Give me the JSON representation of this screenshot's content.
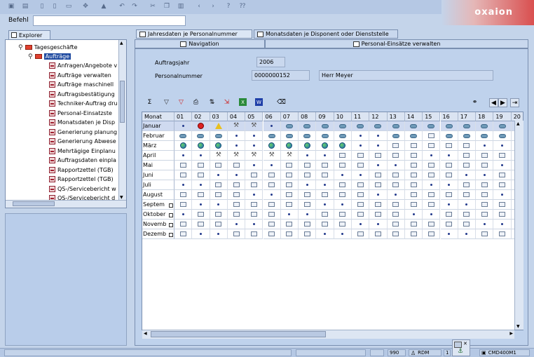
{
  "toolbar": {
    "icons": [
      "save-icon",
      "print-icon",
      "document-icon",
      "new-document-icon",
      "move-icon",
      "stamp-icon",
      "undo-icon",
      "redo-icon",
      "cut-icon",
      "copy-icon",
      "paste-icon",
      "arrow-left-icon",
      "arrow-right-icon",
      "help-icon",
      "context-help-icon"
    ]
  },
  "logo": {
    "text": "oxaion"
  },
  "command": {
    "label": "Befehl",
    "value": ""
  },
  "explorer": {
    "tab_label": "Explorer",
    "tree": {
      "root": "Tagesgeschäfte",
      "folder": "Aufträge",
      "items": [
        "Anfragen/Angebote v",
        "Aufträge verwalten",
        "Aufträge maschinell",
        "Auftragsbestätigung",
        "Techniker-Auftrag dru",
        "Personal-Einsatzste",
        "Monatsdaten je Disp",
        "Generierung planung",
        "Generierung Abwese",
        "Mehrtägige Einplanu",
        "Auftragsdaten einpla",
        "Rapportzettel (TGB)",
        "Rapportzettel (TGB)",
        "QS-/Servicebericht w",
        "QS-/Servicebericht d"
      ]
    }
  },
  "tabs": {
    "row1": [
      "Jahresdaten je Personalnummer",
      "Monatsdaten je Disponent oder Dienststelle"
    ],
    "row2": [
      "Navigation",
      "Personal-Einsätze verwalten"
    ]
  },
  "form": {
    "year_label": "Auftragsjahr",
    "year_value": "2006",
    "personnel_label": "Personalnummer",
    "personnel_value": "0000000152",
    "personnel_name": "Herr Meyer"
  },
  "grid": {
    "month_header": "Monat",
    "day_headers": [
      "01",
      "02",
      "03",
      "04",
      "05",
      "06",
      "07",
      "08",
      "09",
      "10",
      "11",
      "12",
      "13",
      "14",
      "15",
      "16",
      "17",
      "18",
      "19",
      "20"
    ],
    "months": [
      "Januar",
      "Februar",
      "März",
      "April",
      "Mai",
      "Juni",
      "Juli",
      "August",
      "Septem",
      "Oktober",
      "Novemb",
      "Dezemb"
    ],
    "cells": [
      [
        "dot",
        "stop",
        "warn",
        "tool",
        "tool",
        "dot",
        "cloud",
        "cloud",
        "cloud",
        "cloud",
        "cloud",
        "cloud",
        "cloud",
        "cloud",
        "cloud",
        "cloud",
        "cloud",
        "cloud",
        "cloud",
        "cloud"
      ],
      [
        "cloud",
        "cloud",
        "cloud",
        "dot",
        "dot",
        "cloud",
        "cloud",
        "cloud",
        "cloud",
        "cloud",
        "dot",
        "dot",
        "cloud",
        "cloud",
        "box",
        "cloud",
        "cloud",
        "cloud",
        "cloud",
        "dot"
      ],
      [
        "globe",
        "globe",
        "globe",
        "dot",
        "dot",
        "globe",
        "globe",
        "globe",
        "globe",
        "globe",
        "dot",
        "dot",
        "box",
        "box",
        "box",
        "box",
        "box",
        "dot",
        "dot",
        "box"
      ],
      [
        "dot",
        "dot",
        "tool",
        "tool",
        "tool",
        "tool",
        "tool",
        "dot",
        "dot",
        "box",
        "box",
        "box",
        "box",
        "box",
        "dot",
        "dot",
        "box",
        "box",
        "box",
        "box"
      ],
      [
        "box",
        "box",
        "box",
        "box",
        "dot",
        "dot",
        "box",
        "box",
        "box",
        "box",
        "box",
        "dot",
        "dot",
        "box",
        "box",
        "box",
        "box",
        "box",
        "dot",
        "dot"
      ],
      [
        "box",
        "box",
        "dot",
        "dot",
        "box",
        "box",
        "box",
        "box",
        "box",
        "dot",
        "dot",
        "box",
        "box",
        "box",
        "box",
        "box",
        "dot",
        "dot",
        "box",
        "box"
      ],
      [
        "dot",
        "dot",
        "box",
        "box",
        "box",
        "box",
        "box",
        "dot",
        "dot",
        "box",
        "box",
        "box",
        "box",
        "box",
        "dot",
        "dot",
        "box",
        "box",
        "box",
        "box"
      ],
      [
        "box",
        "box",
        "box",
        "box",
        "dot",
        "dot",
        "box",
        "box",
        "box",
        "box",
        "box",
        "dot",
        "dot",
        "box",
        "box",
        "box",
        "box",
        "box",
        "dot",
        "dot"
      ],
      [
        "box",
        "dot",
        "dot",
        "box",
        "box",
        "box",
        "box",
        "box",
        "dot",
        "dot",
        "box",
        "box",
        "box",
        "box",
        "box",
        "dot",
        "dot",
        "box",
        "box",
        "box"
      ],
      [
        "dot",
        "box",
        "box",
        "box",
        "box",
        "box",
        "dot",
        "dot",
        "box",
        "box",
        "box",
        "box",
        "box",
        "dot",
        "dot",
        "box",
        "box",
        "box",
        "box",
        "box"
      ],
      [
        "box",
        "box",
        "box",
        "dot",
        "dot",
        "box",
        "box",
        "box",
        "box",
        "box",
        "dot",
        "dot",
        "box",
        "box",
        "box",
        "box",
        "box",
        "dot",
        "dot",
        "box"
      ],
      [
        "box",
        "dot",
        "dot",
        "box",
        "box",
        "box",
        "box",
        "box",
        "dot",
        "dot",
        "box",
        "box",
        "box",
        "box",
        "box",
        "dot",
        "dot",
        "box",
        "box",
        "box"
      ]
    ]
  },
  "statusbar": {
    "code": "990",
    "user": "RDM",
    "field": "1",
    "program": "CMD400M1"
  }
}
